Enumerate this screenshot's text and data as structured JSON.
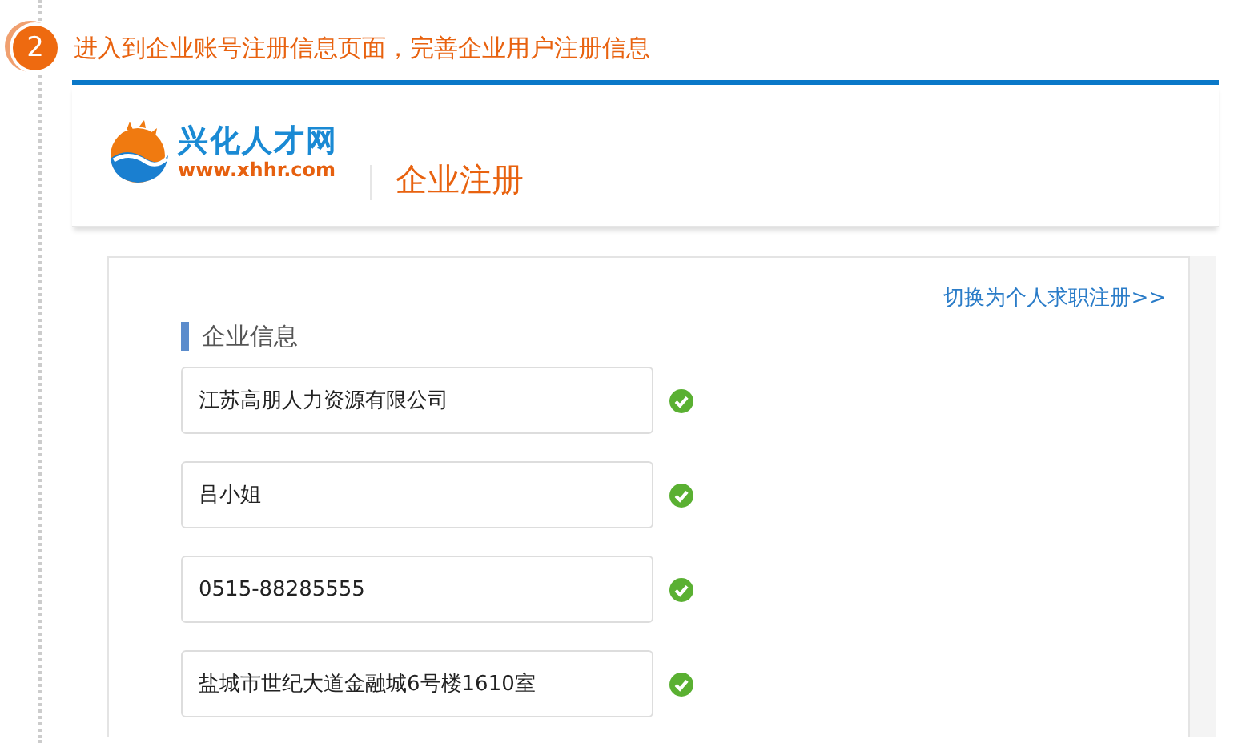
{
  "step": {
    "number": "2",
    "title": "进入到企业账号注册信息页面，完善企业用户注册信息"
  },
  "header": {
    "logo_name": "兴化人才网",
    "logo_url": "www.xhhr.com",
    "page_title": "企业注册"
  },
  "switch_link": "切换为个人求职注册>>",
  "section_title": "企业信息",
  "fields": [
    {
      "value": "江苏高朋人力资源有限公司",
      "valid": true
    },
    {
      "value": "吕小姐",
      "valid": true
    },
    {
      "value": "0515-88285555",
      "valid": true
    },
    {
      "value": "盐城市世纪大道金融城6号楼1610室",
      "valid": true
    }
  ]
}
